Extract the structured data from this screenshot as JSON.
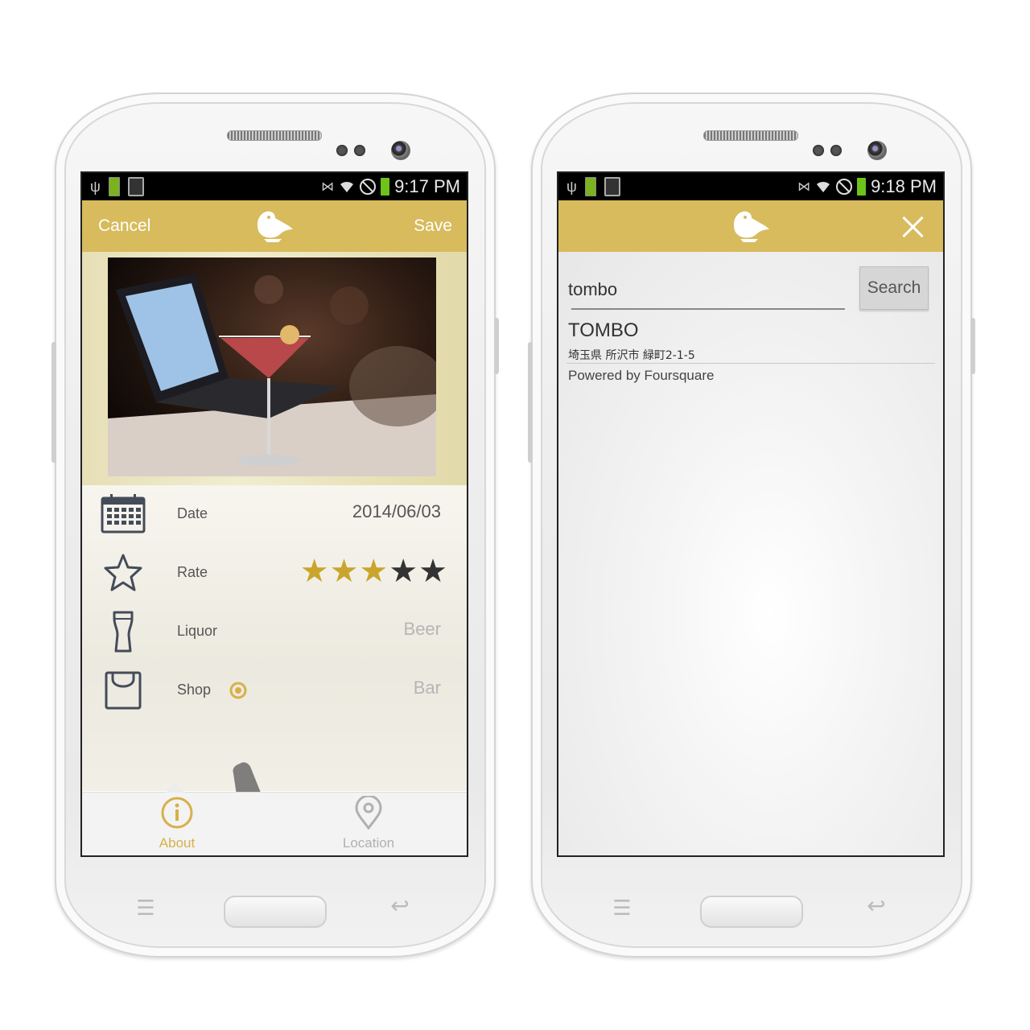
{
  "left_phone": {
    "status": {
      "time": "9:17 PM",
      "battery_badge": "100%"
    },
    "actionbar": {
      "cancel_label": "Cancel",
      "save_label": "Save",
      "logo_icon": "bird-logo-icon"
    },
    "form": {
      "date": {
        "label": "Date",
        "value": "2014/06/03",
        "icon": "calendar-icon"
      },
      "rate": {
        "label": "Rate",
        "value": 3,
        "max": 5,
        "icon": "star-outline-icon"
      },
      "liquor": {
        "label": "Liquor",
        "value": "Beer",
        "icon": "glass-icon"
      },
      "shop": {
        "label": "Shop",
        "value": "Bar",
        "icon": "shopping-bag-icon",
        "location_icon": "location-target-icon"
      }
    },
    "tabs": [
      {
        "label": "About",
        "icon": "info-icon",
        "active": true
      },
      {
        "label": "Location",
        "icon": "map-pin-icon",
        "active": false
      }
    ],
    "colors": {
      "accent": "#d7bb5c",
      "active_tab": "#d7b04a",
      "inactive_tab": "#b0b0b0",
      "star_filled": "#c9a52e",
      "star_empty": "#333333"
    }
  },
  "right_phone": {
    "status": {
      "time": "9:18 PM",
      "battery_badge": "100%"
    },
    "actionbar": {
      "logo_icon": "bird-logo-icon",
      "close_icon": "close-icon"
    },
    "search": {
      "value": "tombo",
      "button_label": "Search"
    },
    "results": [
      {
        "name": "TOMBO",
        "address": "埼玉県 所沢市 緑町2-1-5"
      }
    ],
    "attribution": "Powered by Foursquare"
  }
}
